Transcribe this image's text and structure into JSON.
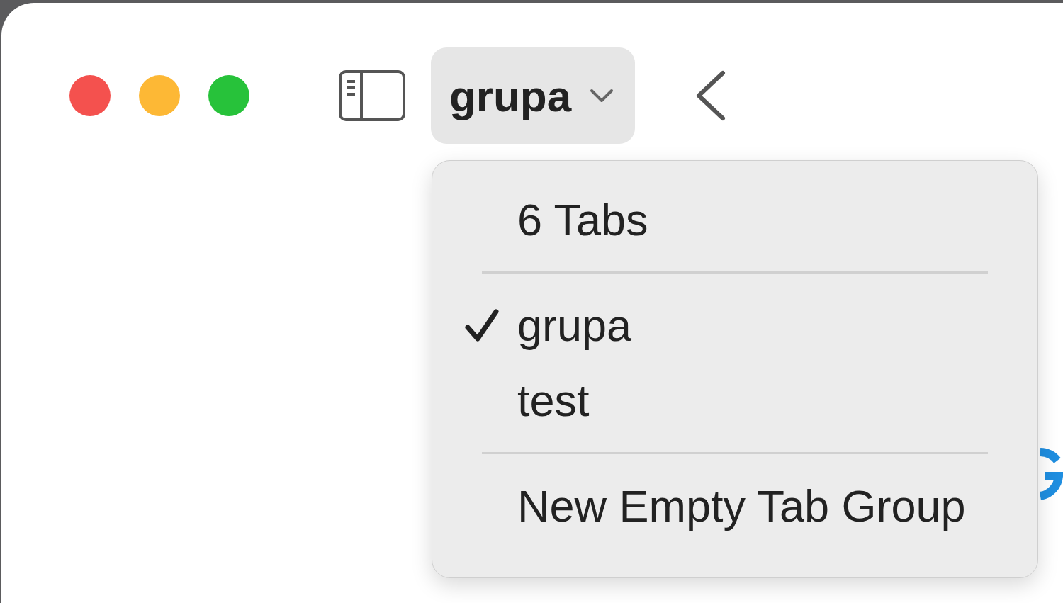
{
  "toolbar": {
    "tab_group_button": {
      "label": "grupa"
    }
  },
  "tab_group_menu": {
    "items": [
      {
        "kind": "info",
        "label": "6 Tabs"
      },
      {
        "kind": "separator"
      },
      {
        "kind": "group",
        "label": "grupa",
        "selected": true
      },
      {
        "kind": "group",
        "label": "test",
        "selected": false
      },
      {
        "kind": "separator"
      },
      {
        "kind": "action",
        "label": "New Empty Tab Group"
      }
    ]
  }
}
